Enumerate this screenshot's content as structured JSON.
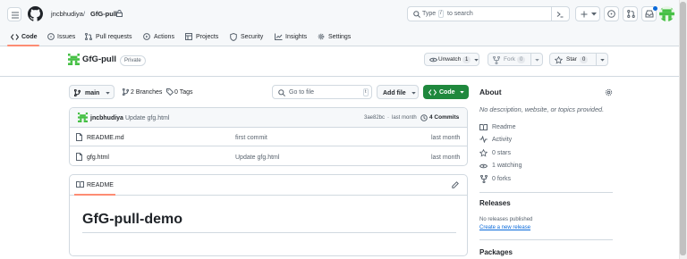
{
  "header": {
    "owner": "jncbhudiya",
    "separator": "/",
    "repo": "GfG-pull",
    "search_placeholder_before": "Type",
    "search_key": "/",
    "search_placeholder_after": "to search"
  },
  "nav": {
    "tabs": [
      {
        "label": "Code"
      },
      {
        "label": "Issues"
      },
      {
        "label": "Pull requests"
      },
      {
        "label": "Actions"
      },
      {
        "label": "Projects"
      },
      {
        "label": "Security"
      },
      {
        "label": "Insights"
      },
      {
        "label": "Settings"
      }
    ]
  },
  "repo": {
    "name": "GfG-pull",
    "visibility": "Private",
    "unwatch_label": "Unwatch",
    "unwatch_count": "1",
    "fork_label": "Fork",
    "fork_count": "0",
    "star_label": "Star",
    "star_count": "0"
  },
  "toolbar": {
    "branch": "main",
    "branches": "2 Branches",
    "tags": "0 Tags",
    "goto_placeholder": "Go to file",
    "goto_key": "t",
    "add_file": "Add file",
    "code": "Code"
  },
  "commit": {
    "author": "jncbhudiya",
    "message": "Update gfg.html",
    "hash": "3ae82bc",
    "dot": "·",
    "time": "last month",
    "commits": "4 Commits"
  },
  "files": [
    {
      "name": "README.md",
      "message": "first commit",
      "time": "last month"
    },
    {
      "name": "gfg.html",
      "message": "Update gfg.html",
      "time": "last month"
    }
  ],
  "readme": {
    "tab": "README",
    "heading": "GfG-pull-demo"
  },
  "sidebar": {
    "about_title": "About",
    "description": "No description, website, or topics provided.",
    "items": [
      {
        "label": "Readme"
      },
      {
        "label": "Activity"
      },
      {
        "label": "0 stars"
      },
      {
        "label": "1 watching"
      },
      {
        "label": "0 forks"
      }
    ],
    "releases_title": "Releases",
    "no_releases": "No releases published",
    "create_release": "Create a new release",
    "packages_title": "Packages"
  },
  "colors": {
    "accent_green": "#1f883d",
    "link_blue": "#0969da",
    "tab_underline": "#fd8c73"
  }
}
